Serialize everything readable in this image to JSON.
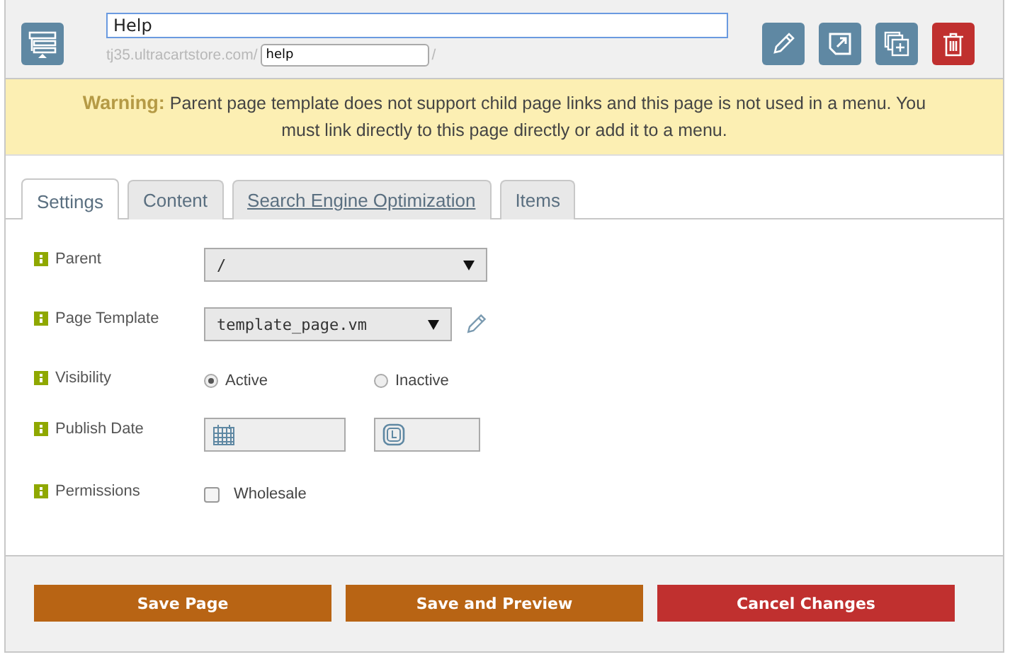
{
  "header": {
    "title": "Help",
    "url_prefix": "tj35.ultracartstore.com/",
    "slug": "help",
    "url_suffix": "/"
  },
  "warning": {
    "label": "Warning:",
    "text": "Parent page template does not support child page links and this page is not used in a menu. You must link directly to this page directly or add it to a menu."
  },
  "tabs": [
    {
      "label": "Settings",
      "selected": true
    },
    {
      "label": "Content",
      "selected": false
    },
    {
      "label": "Search Engine Optimization",
      "selected": false
    },
    {
      "label": "Items",
      "selected": false
    }
  ],
  "fields": [
    {
      "kind": "select",
      "label": "Parent",
      "value": "/",
      "wide": true
    },
    {
      "kind": "select",
      "label": "Page Template",
      "value": "template_page.vm",
      "wide": false,
      "editable": true
    },
    {
      "kind": "radio",
      "label": "Visibility",
      "options": [
        {
          "label": "Active",
          "selected": true
        },
        {
          "label": "Inactive",
          "selected": false
        }
      ]
    },
    {
      "kind": "datetime",
      "label": "Publish Date"
    },
    {
      "kind": "checkbox",
      "label": "Permissions",
      "options": [
        {
          "label": "Wholesale",
          "checked": false
        }
      ]
    }
  ],
  "buttons": [
    {
      "label": "Save Page",
      "kind": "primary"
    },
    {
      "label": "Save and Preview",
      "kind": "primary"
    },
    {
      "label": "Cancel Changes",
      "kind": "danger"
    }
  ]
}
